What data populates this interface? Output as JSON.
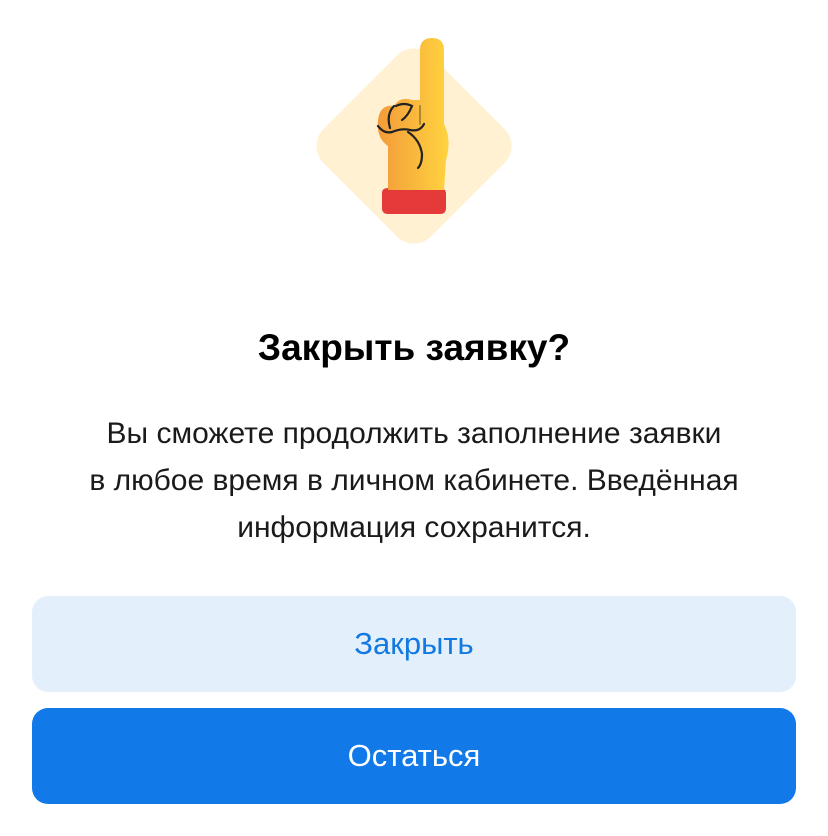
{
  "dialog": {
    "illustration_icon": "pointing-up-hand-icon",
    "title": "Закрыть заявку?",
    "message_lines": [
      "Вы сможете продолжить заполнение заявки",
      "в любое время в личном кабинете. Введённая",
      "информация сохранится."
    ],
    "close_button_label": "Закрыть",
    "stay_button_label": "Остаться"
  },
  "colors": {
    "primary_blue": "#1279e9",
    "secondary_button_bg": "#e3f0fc",
    "illustration_bg": "#fff1d2",
    "hand_yellow": "#ffc83d",
    "hand_orange": "#f6a53a",
    "cuff_red": "#e53a3a"
  }
}
